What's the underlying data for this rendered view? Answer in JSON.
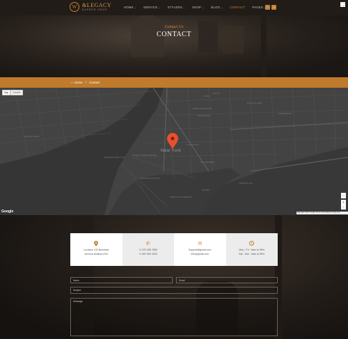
{
  "header": {
    "logo": {
      "mark": "W",
      "title": "&LEGACY",
      "subtitle": "BARBER SHOP"
    },
    "nav": [
      {
        "label": "HOME",
        "dropdown": true,
        "active": false
      },
      {
        "label": "SERVICE",
        "dropdown": true,
        "active": false
      },
      {
        "label": "STYLERS",
        "dropdown": true,
        "active": false
      },
      {
        "label": "SHOP",
        "dropdown": true,
        "active": false
      },
      {
        "label": "BLOG",
        "dropdown": true,
        "active": false
      },
      {
        "label": "CONTACT",
        "dropdown": false,
        "active": true
      },
      {
        "label": "PAGES",
        "dropdown": true,
        "active": false
      }
    ],
    "cart_icon": "cart-icon",
    "search_icon": "search-icon"
  },
  "hero": {
    "subtitle": "Contact Us",
    "title": "CONTACT"
  },
  "breadcrumb": {
    "home": "Home",
    "separator": "/",
    "current": "Contact"
  },
  "map": {
    "type_buttons": [
      "Map",
      "Satellite"
    ],
    "city_label": "New York",
    "labels": [
      "NOHO",
      "EAST VILLAGE",
      "LOWER MANHATTAN",
      "CHINATOWN",
      "NOLITA",
      "BATTERY PARK CITY",
      "WORLD TRADE CENTER",
      "FINANCIAL DISTRICT",
      "PAULUS HOOK",
      "TWO BRIDGES",
      "LITTLE ITALY",
      "BROOKLYN HEIGHTS",
      "DUMBO",
      "VINEGAR HILL",
      "GREENPOINT"
    ],
    "google_logo": "Google",
    "attribution": "Map data ©2017 Google  Terms of Use  Report a map error",
    "marker_color": "#e8502e"
  },
  "contact_cards": [
    {
      "icon": "map-marker-icon",
      "lines": [
        "Location 132 Business",
        "Avenue,Mutima,USA"
      ]
    },
    {
      "icon": "phone-icon",
      "lines": [
        "+1 222 456 7890",
        "+1 987 654 3322"
      ]
    },
    {
      "icon": "envelope-icon",
      "lines": [
        "Support@gmail.com",
        "info@gmail.com"
      ]
    },
    {
      "icon": "clock-icon",
      "lines": [
        "Mon - Fri : 9am to 5Pm",
        "Sat - Sun : 9am to 5Pm"
      ]
    }
  ],
  "form": {
    "name_placeholder": "Name",
    "email_placeholder": "Email",
    "subject_placeholder": "Subject",
    "message_placeholder": "Message"
  },
  "colors": {
    "accent": "#c8802f",
    "breadcrumb_bg": "#c07a2b",
    "map_bg": "#434343"
  }
}
